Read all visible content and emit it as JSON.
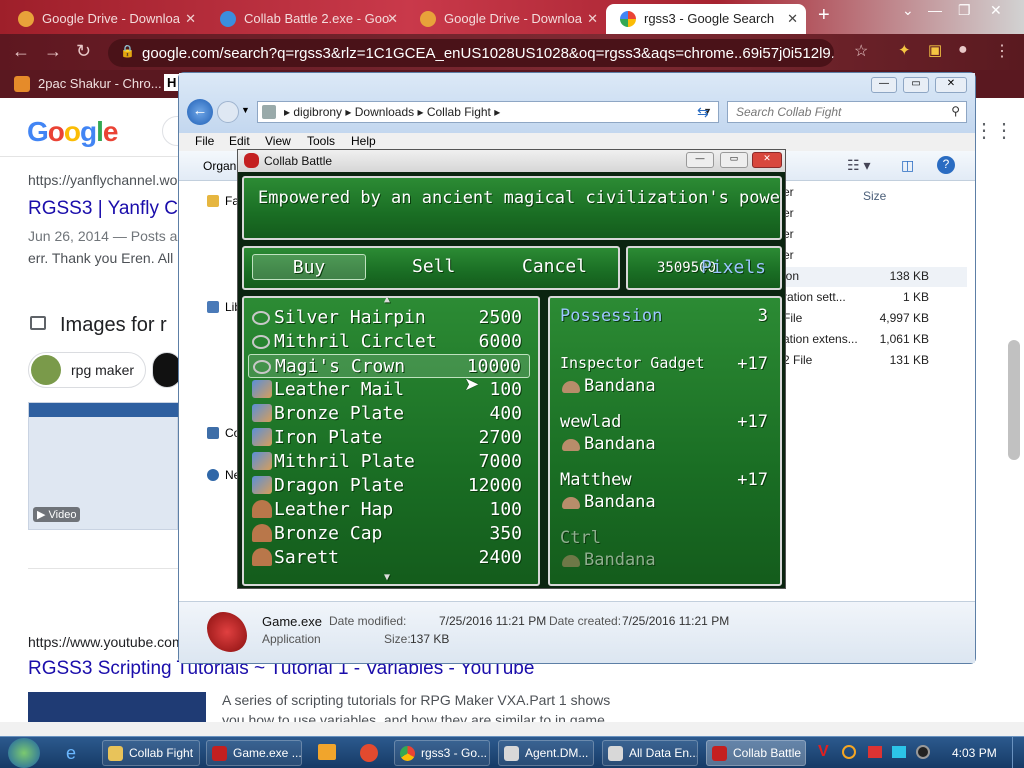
{
  "browser": {
    "tabs": [
      {
        "label": "Google Drive - Downloa",
        "active": false
      },
      {
        "label": "Collab Battle 2.exe - Goo",
        "active": false
      },
      {
        "label": "Google Drive - Downloa",
        "active": false
      },
      {
        "label": "rgss3 - Google Search",
        "active": true
      }
    ],
    "url": "google.com/search?q=rgss3&rlz=1C1GCEA_enUS1028US1028&oq=rgss3&aqs=chrome..69i57j0i512l9.825j...",
    "bookmark": "2pac Shakur - Chro...",
    "bookmark2": "H"
  },
  "google": {
    "logo": "Google",
    "result1_url": "https://yanflychannel.wo",
    "result1_title": "RGSS3 | Yanfly C",
    "result1_meta": "Jun 26, 2014 — Posts a",
    "result1_snippet": "err. Thank you Eren. All",
    "images_heading": "Images for r",
    "chip_rpg": "rpg maker",
    "video_label": "Video",
    "result2_url": "https://www.youtube.com",
    "result2_title": "RGSS3 Scripting Tutorials ~ Tutorial 1 - Variables - YouTube",
    "result2_snippet": "A series of scripting tutorials for RPG Maker VXA.Part 1 shows",
    "result2_snippet2": "you how to use variables, and how they are similar to in game"
  },
  "explorer": {
    "path": [
      "digibrony",
      "Downloads",
      "Collab Fight"
    ],
    "search_placeholder": "Search Collab Fight",
    "menu": [
      "File",
      "Edit",
      "View",
      "Tools",
      "Help"
    ],
    "organize": "Organi",
    "nav": [
      "Fa",
      "Lib",
      "Co",
      "Ne"
    ],
    "size_header": "Size",
    "files": [
      {
        "type": "er",
        "size": ""
      },
      {
        "type": "er",
        "size": ""
      },
      {
        "type": "er",
        "size": ""
      },
      {
        "type": "er",
        "size": ""
      },
      {
        "type": "ion",
        "size": "138 KB"
      },
      {
        "type": "ration sett...",
        "size": "1 KB"
      },
      {
        "type": "File",
        "size": "4,997 KB"
      },
      {
        "type": "ation extens...",
        "size": "1,061 KB"
      },
      {
        "type": "2 File",
        "size": "131 KB"
      }
    ],
    "status": {
      "filename": "Game.exe",
      "filetype": "Application",
      "modified_label": "Date modified:",
      "modified": "7/25/2016 11:21 PM",
      "size_label": "Size:",
      "size": "137 KB",
      "created_label": "Date created:",
      "created": "7/25/2016 11:21 PM"
    }
  },
  "game": {
    "title": "Collab Battle",
    "help": "Empowered by an ancient magical civilization's power",
    "commands": [
      "Buy",
      "Sell",
      "Cancel"
    ],
    "gold_value": "3509500",
    "gold_unit": "Pixels",
    "items": [
      {
        "name": "Silver Hairpin",
        "price": "2500",
        "icon": "ring"
      },
      {
        "name": "Mithril Circlet",
        "price": "6000",
        "icon": "ring"
      },
      {
        "name": "Magi's Crown",
        "price": "10000",
        "icon": "ring"
      },
      {
        "name": "Leather Mail",
        "price": "100",
        "icon": "armor"
      },
      {
        "name": "Bronze Plate",
        "price": "400",
        "icon": "armor"
      },
      {
        "name": "Iron Plate",
        "price": "2700",
        "icon": "armor"
      },
      {
        "name": "Mithril Plate",
        "price": "7000",
        "icon": "armor"
      },
      {
        "name": "Dragon Plate",
        "price": "12000",
        "icon": "armor"
      },
      {
        "name": "Leather Hap",
        "price": "100",
        "icon": "helm"
      },
      {
        "name": "Bronze Cap",
        "price": "350",
        "icon": "helm"
      },
      {
        "name": "Sarett",
        "price": "2400",
        "icon": "helm"
      }
    ],
    "possession_label": "Possession",
    "possession_value": "3",
    "actors": [
      {
        "name": "Inspector Gadget",
        "change": "+17",
        "equip": "Bandana"
      },
      {
        "name": "wewlad",
        "change": "+17",
        "equip": "Bandana"
      },
      {
        "name": "Matthew",
        "change": "+17",
        "equip": "Bandana"
      },
      {
        "name": "Ctrl",
        "change": "",
        "equip": "Bandana"
      }
    ]
  },
  "taskbar": {
    "items": [
      "Collab Fight",
      "Game.exe ...",
      "rgss3 - Go...",
      "Agent.DM...",
      "All Data En...",
      "Collab Battle"
    ],
    "time": "4:03 PM"
  }
}
